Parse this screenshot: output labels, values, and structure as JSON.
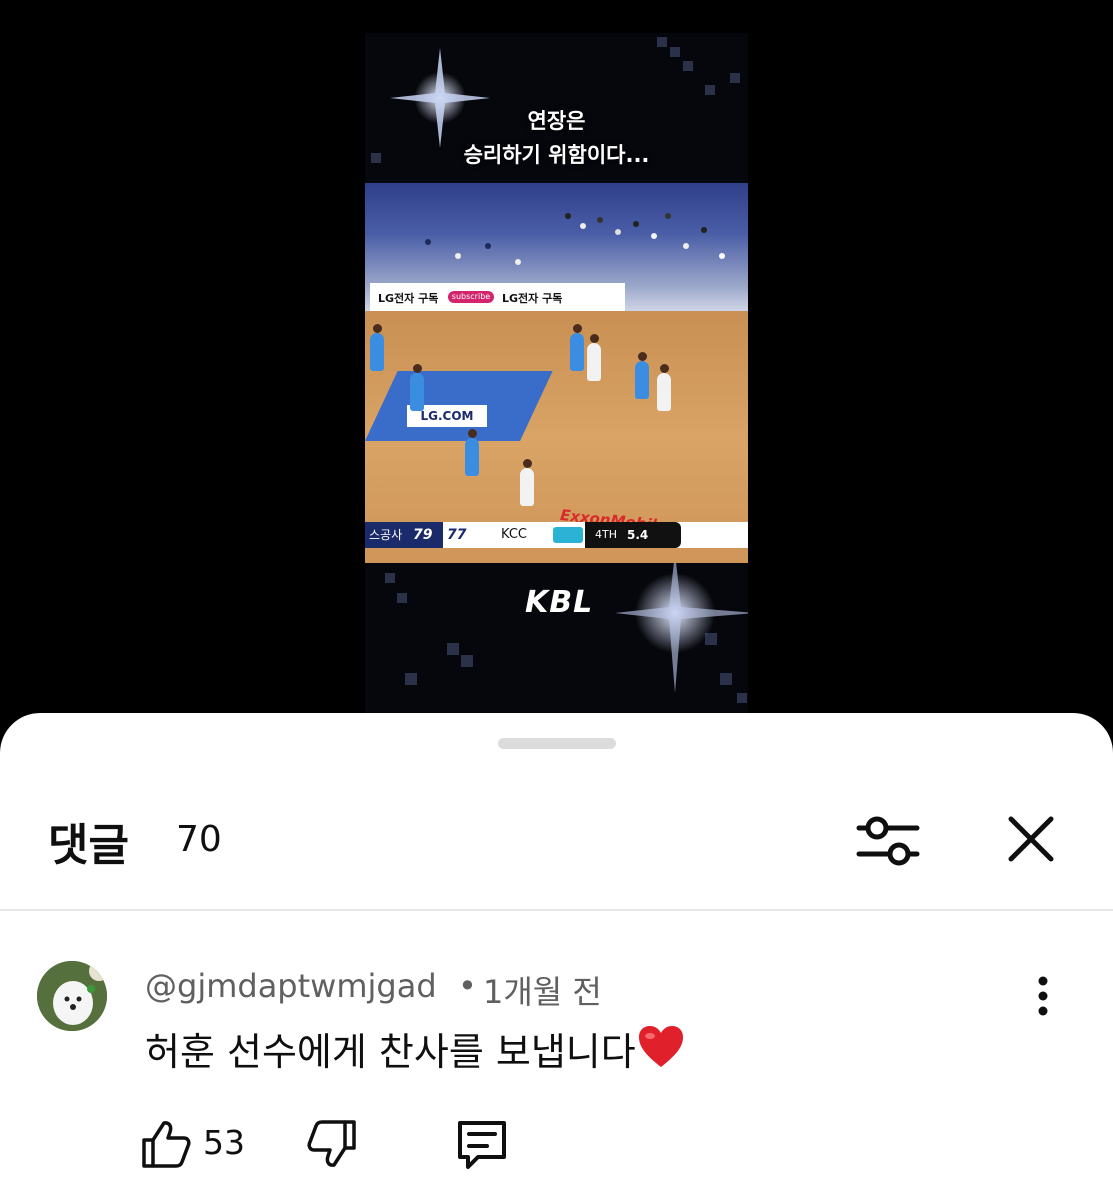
{
  "video": {
    "caption_line1": "연장은",
    "caption_line2": "승리하기 위함이다...",
    "banner_left": "LG전자 구독",
    "banner_pill": "subscribe",
    "banner_right": "LG전자 구독",
    "court_ad": "LG.COM",
    "sponsor": "ExxonMobil",
    "scoreboard": {
      "home_name": "스공사",
      "home_score": "79",
      "away_score": "77",
      "away_name": "KCC",
      "period": "4TH",
      "clock": "5.4"
    },
    "league_logo": "KBL"
  },
  "comments_panel": {
    "title": "댓글",
    "count": "70",
    "filter_icon": "sliders-icon",
    "close_icon": "close-icon",
    "comments": [
      {
        "author": "@gjmdaptwmjgad",
        "separator": "•",
        "time": "1개월 전",
        "text": "허훈 선수에게 찬사를 보냅니다",
        "emoji": "heart-emoji",
        "likes": "53"
      }
    ]
  },
  "colors": {
    "sheet_bg": "#ffffff",
    "text_primary": "#0f0f0f",
    "text_secondary": "#606060",
    "heart": "#e0202a"
  }
}
